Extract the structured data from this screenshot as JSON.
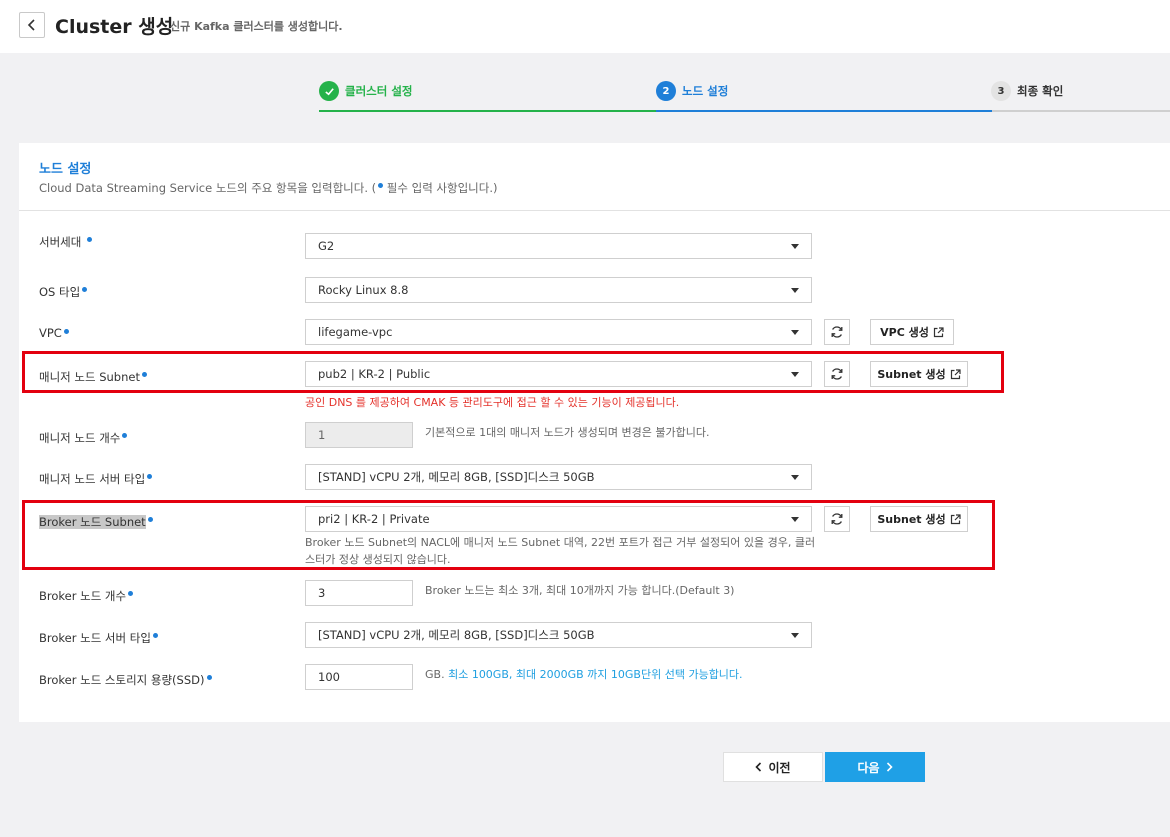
{
  "header": {
    "title": "Cluster 생성",
    "subtitle": "신규 Kafka 클러스터를 생성합니다."
  },
  "steps": [
    {
      "number": "",
      "label": "클러스터 설정",
      "status": "done"
    },
    {
      "number": "2",
      "label": "노드 설정",
      "status": "active"
    },
    {
      "number": "3",
      "label": "최종 확인",
      "status": "pending"
    }
  ],
  "panel": {
    "title": "노드 설정",
    "desc_before": "Cloud Data Streaming Service 노드의 주요 항목을 입력합니다. (",
    "desc_after": " 필수 입력 사항입니다.)"
  },
  "fields": {
    "server_gen": {
      "label": "서버세대",
      "value": "G2"
    },
    "os_type": {
      "label": "OS 타입",
      "value": "Rocky Linux 8.8"
    },
    "vpc": {
      "label": "VPC",
      "value": "lifegame-vpc",
      "create_label": "VPC 생성"
    },
    "manager_subnet": {
      "label": "매니저 노드 Subnet",
      "value": "pub2 | KR-2 | Public",
      "create_label": "Subnet 생성",
      "hint": "공인 DNS 를 제공하여 CMAK 등 관리도구에 접근 할 수 있는 기능이 제공됩니다."
    },
    "manager_count": {
      "label": "매니저 노드 개수",
      "value": "1",
      "hint": "기본적으로 1대의 매니저 노드가 생성되며 변경은 불가합니다."
    },
    "manager_server_type": {
      "label": "매니저 노드 서버 타입",
      "value": "[STAND] vCPU 2개, 메모리 8GB, [SSD]디스크 50GB"
    },
    "broker_subnet": {
      "label": "Broker 노드 Subnet",
      "value": "pri2 | KR-2 | Private",
      "create_label": "Subnet 생성",
      "hint_line1": "Broker 노드 Subnet의 NACL에 매니저 노드 Subnet 대역, 22번 포트가  접근 거부 설정되어 있을 경우, 클러",
      "hint_line2": "스터가 정상 생성되지 않습니다."
    },
    "broker_count": {
      "label": "Broker 노드 개수",
      "value": "3",
      "hint": "Broker 노드는 최소 3개, 최대 10개까지 가능 합니다.(Default 3)"
    },
    "broker_server_type": {
      "label": "Broker 노드 서버 타입",
      "value": "[STAND] vCPU 2개, 메모리 8GB, [SSD]디스크 50GB"
    },
    "broker_storage": {
      "label": "Broker 노드 스토리지 용량(SSD)",
      "value": "100",
      "hint_prefix": "GB. ",
      "hint_blue": "최소 100GB, 최대 2000GB 까지 10GB단위 선택 가능합니다."
    }
  },
  "footer": {
    "prev_label": "이전",
    "next_label": "다음"
  },
  "colors": {
    "accent": "#1f7fd8",
    "success": "#25b24a",
    "highlight_box": "#e3000f",
    "next_button": "#1fa0e6"
  }
}
